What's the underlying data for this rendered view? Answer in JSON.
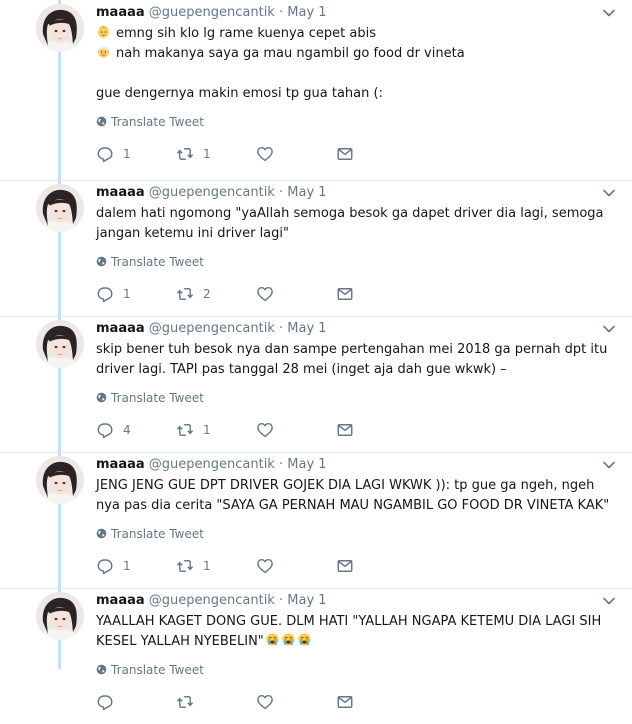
{
  "labels": {
    "translate": "Translate Tweet"
  },
  "tweets": [
    {
      "name": "maaaa",
      "handle": "@guepengencantik",
      "dot": "·",
      "date": "May 1",
      "lines": [
        {
          "text": "emng sih klo lg rame kuenya cepet abis",
          "emoji_before": "baby-face-emoji"
        },
        {
          "text": "nah makanya saya ga mau ngambil go food dr vineta",
          "emoji_before": "old-man-face-emoji"
        },
        {
          "text": ""
        },
        {
          "text": "gue dengernya makin emosi tp gua tahan (:"
        }
      ],
      "reply_count": "1",
      "retweet_count": "1",
      "like_count": ""
    },
    {
      "name": "maaaa",
      "handle": "@guepengencantik",
      "dot": "·",
      "date": "May 1",
      "lines": [
        {
          "text": "dalem hati ngomong \"yaAllah semoga besok ga dapet driver dia lagi, semoga"
        },
        {
          "text": "jangan ketemu ini driver lagi\""
        }
      ],
      "reply_count": "1",
      "retweet_count": "2",
      "like_count": ""
    },
    {
      "name": "maaaa",
      "handle": "@guepengencantik",
      "dot": "·",
      "date": "May 1",
      "lines": [
        {
          "text": "skip bener tuh besok nya dan sampe pertengahan mei 2018 ga pernah dpt itu"
        },
        {
          "text": "driver lagi. TAPI pas tanggal 28 mei (inget aja dah gue wkwk) –"
        }
      ],
      "reply_count": "4",
      "retweet_count": "1",
      "like_count": ""
    },
    {
      "name": "maaaa",
      "handle": "@guepengencantik",
      "dot": "·",
      "date": "May 1",
      "lines": [
        {
          "text": "JENG JENG GUE DPT DRIVER GOJEK DIA LAGI WKWK )): tp gue ga ngeh, ngeh"
        },
        {
          "text": "nya pas dia cerita \"SAYA GA PERNAH MAU NGAMBIL GO FOOD DR VINETA KAK\""
        }
      ],
      "reply_count": "1",
      "retweet_count": "1",
      "like_count": ""
    },
    {
      "name": "maaaa",
      "handle": "@guepengencantik",
      "dot": "·",
      "date": "May 1",
      "lines": [
        {
          "text": "YAALLAH KAGET DONG GUE. DLM HATI \"YALLAH NGAPA KETEMU DIA LAGI SIH"
        },
        {
          "text": "KESEL YALLAH NYEBELIN\"",
          "emoji_after": "loudly-crying-face-emoji"
        }
      ],
      "reply_count": "",
      "retweet_count": "",
      "like_count": ""
    }
  ]
}
